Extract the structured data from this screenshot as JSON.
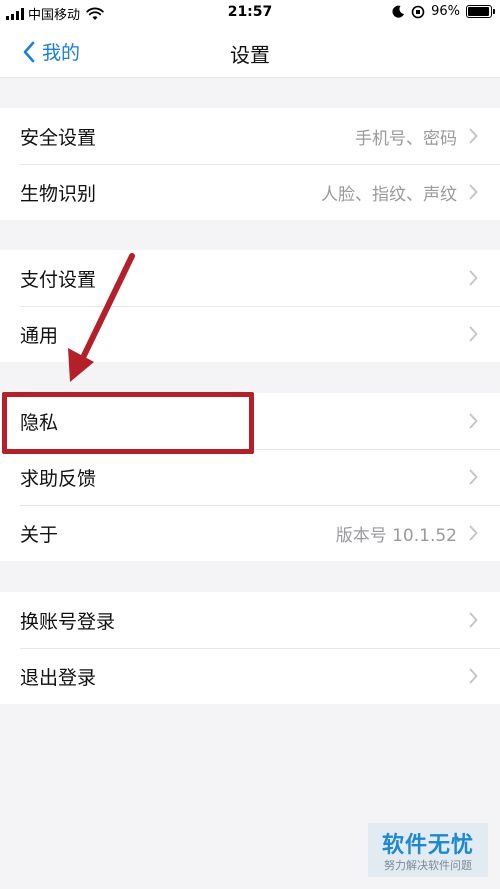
{
  "status_bar": {
    "carrier": "中国移动",
    "time": "21:57",
    "battery": "96%",
    "battery_level": 0.96
  },
  "nav": {
    "back_label": "我的",
    "title": "设置",
    "accent_color": "#1a7de0"
  },
  "groups": [
    {
      "rows": [
        {
          "label": "安全设置",
          "value": "手机号、密码"
        },
        {
          "label": "生物识别",
          "value": "人脸、指纹、声纹"
        }
      ]
    },
    {
      "rows": [
        {
          "label": "支付设置",
          "value": ""
        },
        {
          "label": "通用",
          "value": ""
        }
      ]
    },
    {
      "rows": [
        {
          "label": "隐私",
          "value": ""
        },
        {
          "label": "求助反馈",
          "value": ""
        },
        {
          "label": "关于",
          "value": "版本号 10.1.52"
        }
      ]
    },
    {
      "rows": [
        {
          "label": "换账号登录",
          "value": ""
        },
        {
          "label": "退出登录",
          "value": ""
        }
      ]
    }
  ],
  "annotation": {
    "highlighted_item": "隐私",
    "color": "#b3202a"
  },
  "watermark": {
    "title": "软件无忧",
    "subtitle": "努力解决软件问题"
  }
}
